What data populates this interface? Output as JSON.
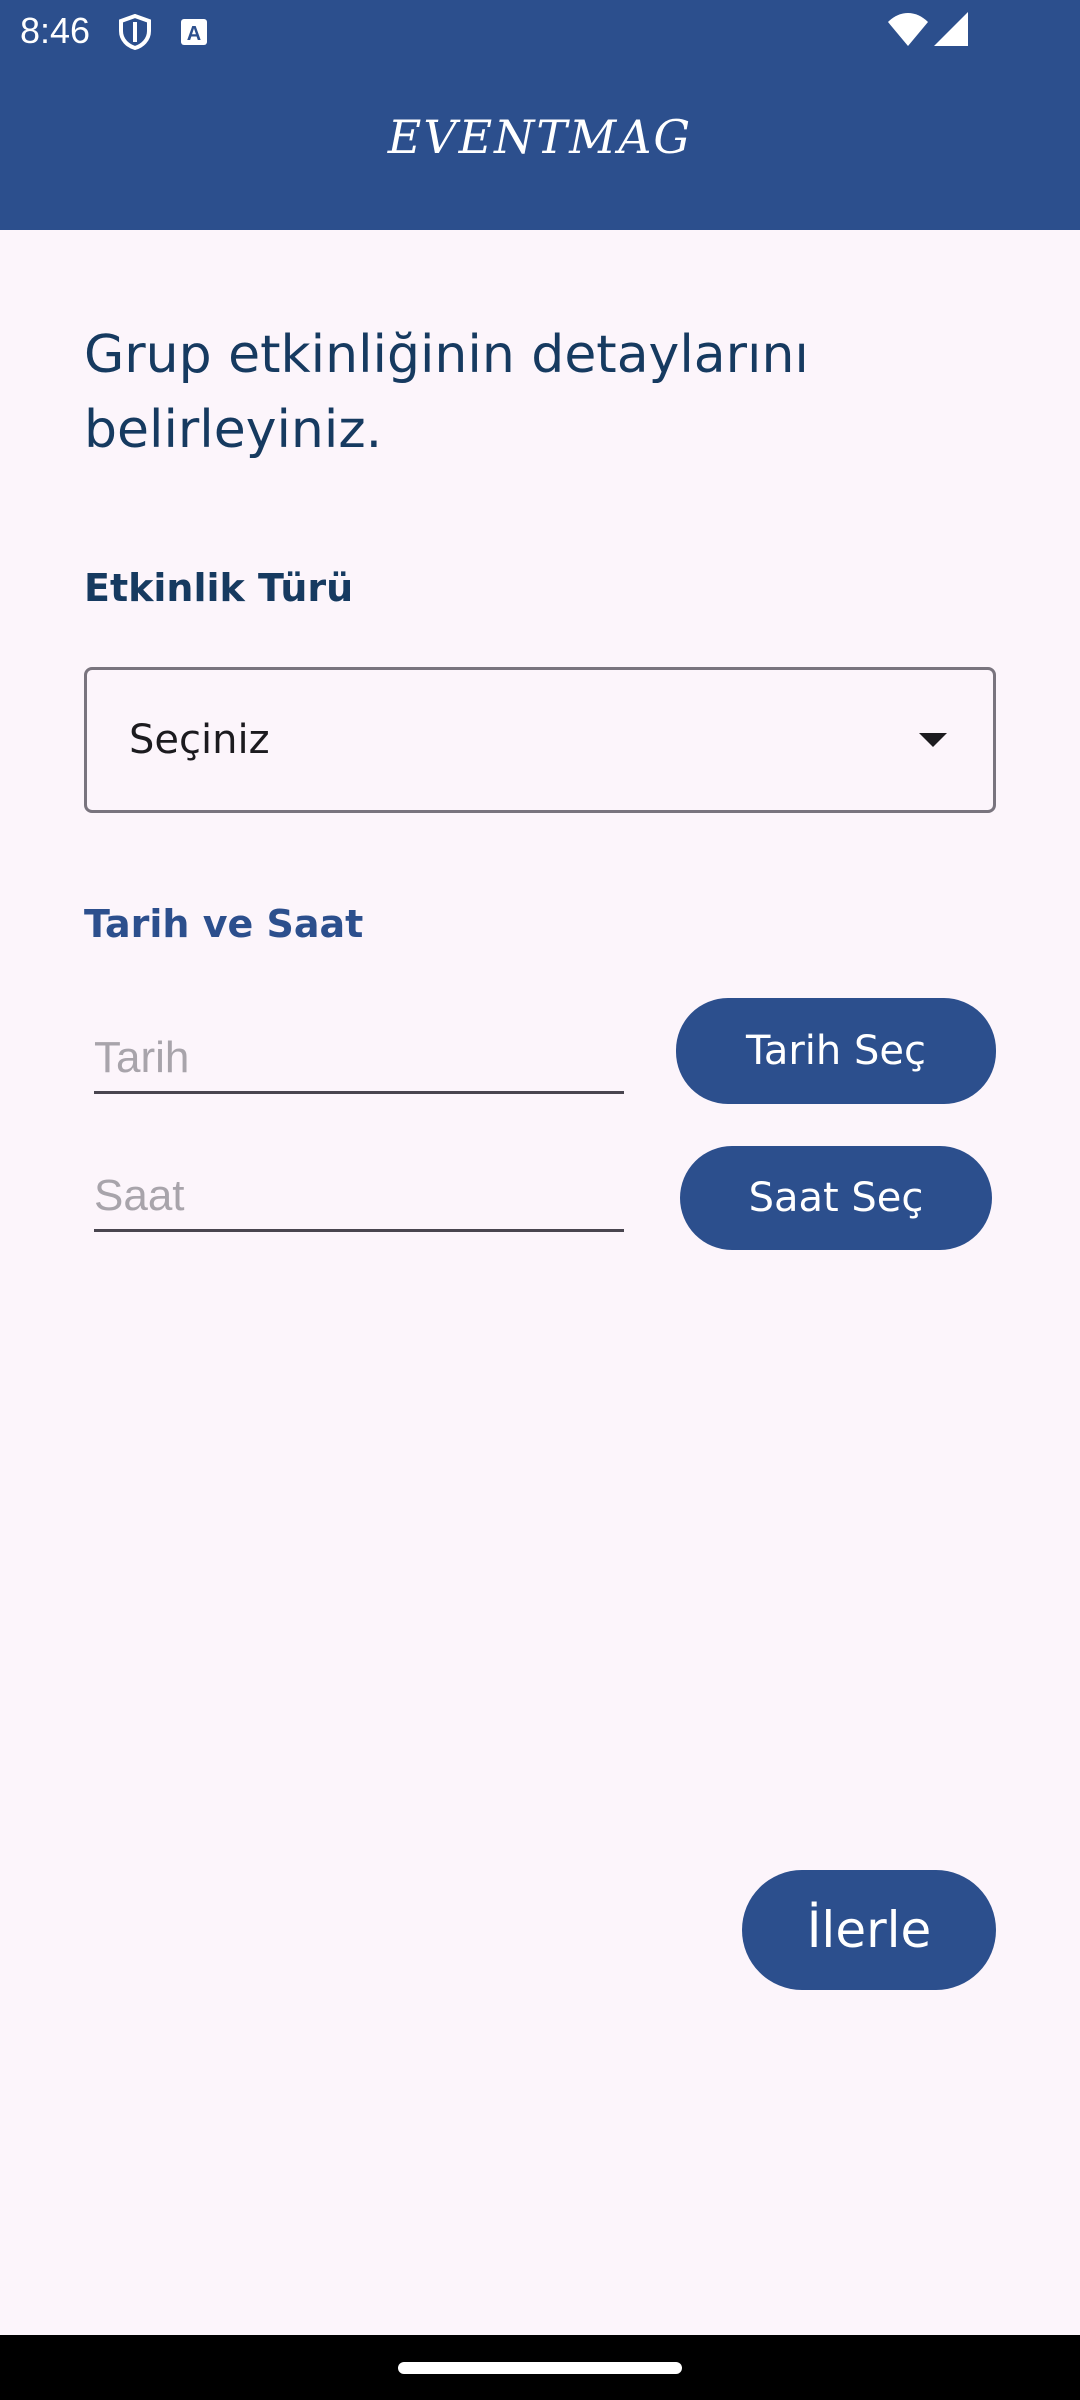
{
  "status_bar": {
    "time": "8:46",
    "left_icons": [
      "shield-icon",
      "text-a-icon"
    ],
    "right_icons": [
      "wifi-icon",
      "signal-icon"
    ]
  },
  "app_bar": {
    "title": "EVENTMAG",
    "color": "#2c4f8d"
  },
  "form": {
    "heading": "Grup etkinliğinin detaylarını belirleyiniz.",
    "event_type": {
      "label": "Etkinlik Türü",
      "selected_value": "Seçiniz"
    },
    "date_time": {
      "label": "Tarih ve Saat",
      "date_placeholder": "Tarih",
      "time_placeholder": "Saat",
      "pick_date_label": "Tarih Seç",
      "pick_time_label": "Saat Seç"
    },
    "next_button_label": "İlerle"
  },
  "colors": {
    "primary": "#2c4f8d",
    "heading_text": "#163a60",
    "background": "#fcf5fb"
  }
}
